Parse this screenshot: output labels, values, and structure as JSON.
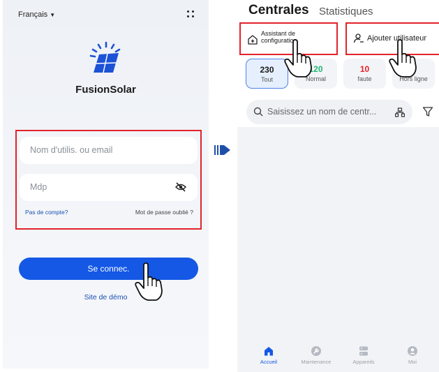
{
  "login": {
    "language": "Français",
    "brand": "FusionSolar",
    "username_placeholder": "Nom d'utilis. ou email",
    "password_placeholder": "Mdp",
    "no_account_link": "Pas de compte?",
    "forgot_link": "Mot de passe oublié ?",
    "login_button": "Se connec.",
    "demo_link": "Site de démo"
  },
  "plants": {
    "title": "Centrales",
    "subtitle": "Statistiques",
    "setup_label": "Assistant de configuration",
    "add_user_label": "Ajouter utilisateur",
    "status": [
      {
        "count": "230",
        "label": "Tout"
      },
      {
        "count": "120",
        "label": "Normal"
      },
      {
        "count": "10",
        "label": "faute"
      },
      {
        "count": "0",
        "label": "Hors ligne"
      }
    ],
    "search_placeholder": "Saisissez un nom de centr...",
    "nav": [
      {
        "label": "Accueil"
      },
      {
        "label": "Maintenance"
      },
      {
        "label": "Appareils"
      },
      {
        "label": "Moi"
      }
    ]
  },
  "colors": {
    "accent": "#1458e5",
    "highlight": "#e3222b",
    "normal": "#22b573",
    "fault": "#e3222b"
  },
  "icons": {
    "arrow": "arrow-right-icon",
    "hand": "pointing-hand-icon"
  }
}
